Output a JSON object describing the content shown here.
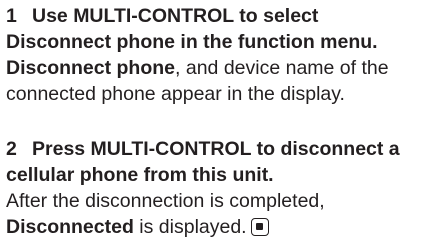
{
  "step1": {
    "number": "1",
    "heading_line1": "Use MULTI-CONTROL to select",
    "heading_line2": "Disconnect phone in the function menu.",
    "body_bold": "Disconnect phone",
    "body_rest_line1": ", and device name of the",
    "body_line2": "connected phone appear in the display."
  },
  "step2": {
    "number": "2",
    "heading_line1": "Press MULTI-CONTROL to disconnect a",
    "heading_line2": "cellular phone from this unit.",
    "body_line1": "After the disconnection is completed,",
    "body_bold": "Disconnected",
    "body_rest_line2": " is displayed.",
    "end_mark_icon": "end-of-section-icon"
  }
}
